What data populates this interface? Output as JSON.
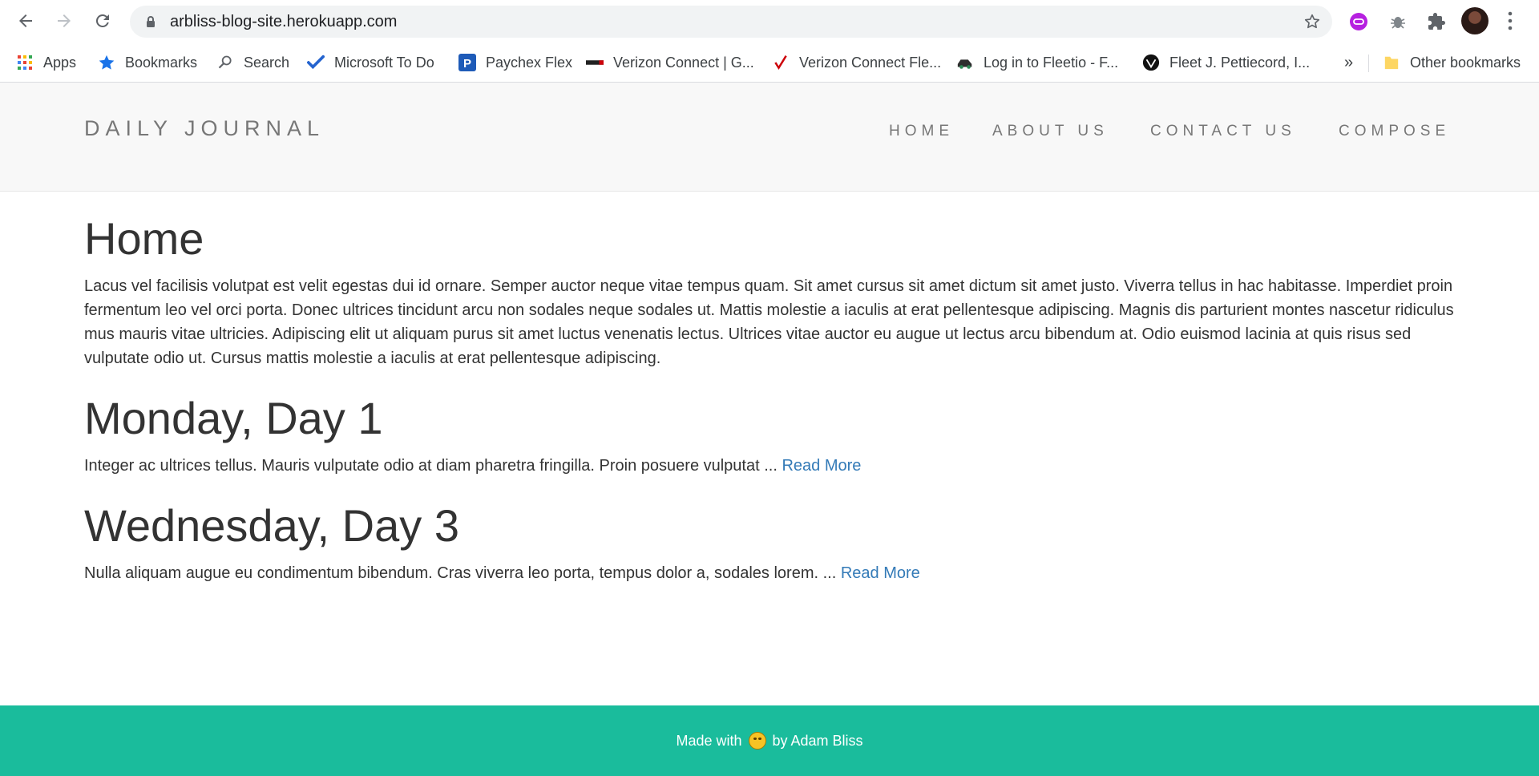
{
  "browser": {
    "url": "arbliss-blog-site.herokuapp.com",
    "bookmarks": [
      {
        "label": "Apps",
        "icon": "apps-grid-icon"
      },
      {
        "label": "Bookmarks",
        "icon": "star-icon"
      },
      {
        "label": "Search",
        "icon": "search-icon"
      },
      {
        "label": "Microsoft To Do",
        "icon": "todo-check-icon"
      },
      {
        "label": "Paychex Flex",
        "icon": "paychex-icon"
      },
      {
        "label": "Verizon Connect | G...",
        "icon": "verizon-icon"
      },
      {
        "label": "Verizon Connect Fle...",
        "icon": "verizon-check-icon"
      },
      {
        "label": "Log in to Fleetio - F...",
        "icon": "fleetio-icon"
      },
      {
        "label": "Fleet J. Pettiecord, I...",
        "icon": "fleet-logo-icon"
      }
    ],
    "overflow": "»",
    "other_bookmarks": "Other bookmarks"
  },
  "site": {
    "brand": "DAILY JOURNAL",
    "nav": [
      "HOME",
      "ABOUT US",
      "CONTACT US",
      "COMPOSE"
    ]
  },
  "main": {
    "title": "Home",
    "intro": "Lacus vel facilisis volutpat est velit egestas dui id ornare. Semper auctor neque vitae tempus quam. Sit amet cursus sit amet dictum sit amet justo. Viverra tellus in hac habitasse. Imperdiet proin fermentum leo vel orci porta. Donec ultrices tincidunt arcu non sodales neque sodales ut. Mattis molestie a iaculis at erat pellentesque adipiscing. Magnis dis parturient montes nascetur ridiculus mus mauris vitae ultricies. Adipiscing elit ut aliquam purus sit amet luctus venenatis lectus. Ultrices vitae auctor eu augue ut lectus arcu bibendum at. Odio euismod lacinia at quis risus sed vulputate odio ut. Cursus mattis molestie a iaculis at erat pellentesque adipiscing.",
    "posts": [
      {
        "title": "Monday, Day 1",
        "excerpt": "Integer ac ultrices tellus. Mauris vulputate odio at diam pharetra fringilla. Proin posuere vulputat ... ",
        "link": "Read More"
      },
      {
        "title": "Wednesday, Day 3",
        "excerpt": "Nulla aliquam augue eu condimentum bibendum. Cras viverra leo porta, tempus dolor a, sodales lorem. ... ",
        "link": "Read More"
      }
    ]
  },
  "footer": {
    "before": "Made with",
    "after": "by Adam Bliss"
  },
  "colors": {
    "footer_bg": "#1abc9c",
    "link": "#337ab7",
    "header_bg": "#f8f8f8"
  }
}
